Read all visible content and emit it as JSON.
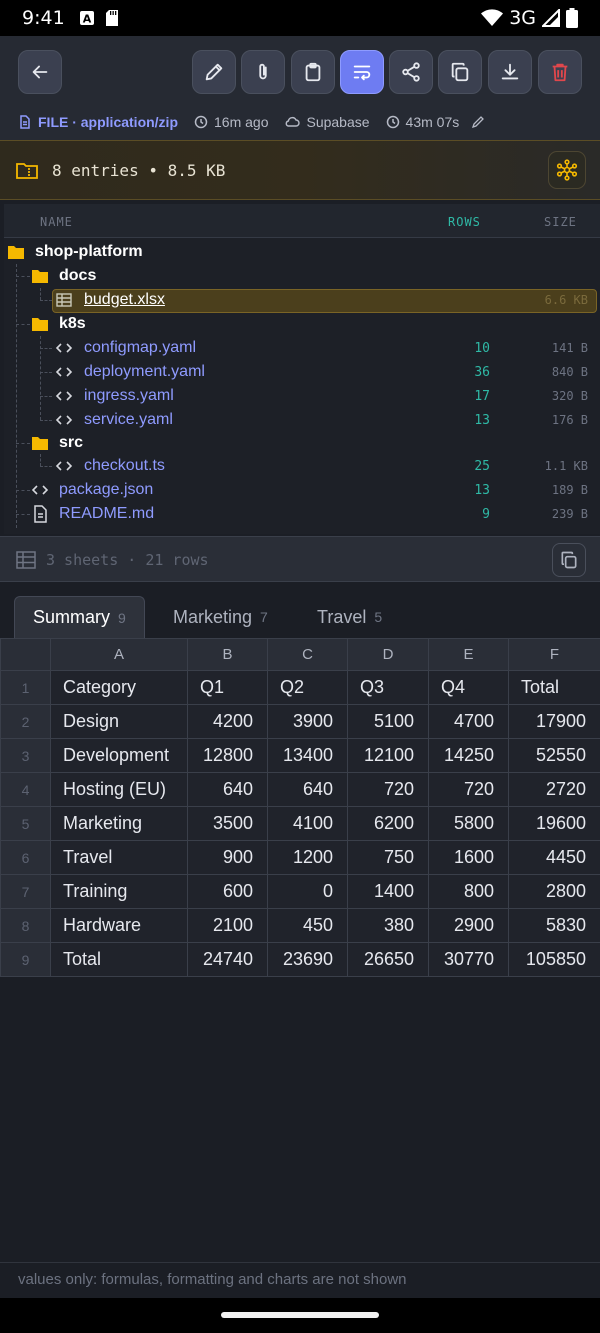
{
  "status": {
    "time": "9:41",
    "network": "3G"
  },
  "meta": {
    "file_label": "FILE · application/zip",
    "age": "16m ago",
    "storage": "Supabase",
    "duration": "43m 07s"
  },
  "banner": {
    "text": "8 entries • 8.5 KB"
  },
  "tree": {
    "headers": {
      "name": "NAME",
      "rows": "ROWS",
      "size": "SIZE"
    },
    "root": "shop-platform",
    "docs": "docs",
    "budget": {
      "name": "budget.xlsx",
      "size": "6.6 KB"
    },
    "k8s": "k8s",
    "configmap": {
      "name": "configmap.yaml",
      "rows": "10",
      "size": "141 B"
    },
    "deployment": {
      "name": "deployment.yaml",
      "rows": "36",
      "size": "840 B"
    },
    "ingress": {
      "name": "ingress.yaml",
      "rows": "17",
      "size": "320 B"
    },
    "service": {
      "name": "service.yaml",
      "rows": "13",
      "size": "176 B"
    },
    "src": "src",
    "checkout": {
      "name": "checkout.ts",
      "rows": "25",
      "size": "1.1 KB"
    },
    "package": {
      "name": "package.json",
      "rows": "13",
      "size": "189 B"
    },
    "readme": {
      "name": "README.md",
      "rows": "9",
      "size": "239 B"
    }
  },
  "sheets": {
    "summary": "3 sheets · 21 rows"
  },
  "tabs": [
    {
      "label": "Summary",
      "count": "9"
    },
    {
      "label": "Marketing",
      "count": "7"
    },
    {
      "label": "Travel",
      "count": "5"
    }
  ],
  "grid": {
    "columns": [
      "A",
      "B",
      "C",
      "D",
      "E",
      "F"
    ],
    "rows": [
      {
        "n": "1",
        "cells": [
          "Category",
          "Q1",
          "Q2",
          "Q3",
          "Q4",
          "Total"
        ]
      },
      {
        "n": "2",
        "cells": [
          "Design",
          "4200",
          "3900",
          "5100",
          "4700",
          "17900"
        ]
      },
      {
        "n": "3",
        "cells": [
          "Development",
          "12800",
          "13400",
          "12100",
          "14250",
          "52550"
        ]
      },
      {
        "n": "4",
        "cells": [
          "Hosting (EU)",
          "640",
          "640",
          "720",
          "720",
          "2720"
        ]
      },
      {
        "n": "5",
        "cells": [
          "Marketing",
          "3500",
          "4100",
          "6200",
          "5800",
          "19600"
        ]
      },
      {
        "n": "6",
        "cells": [
          "Travel",
          "900",
          "1200",
          "750",
          "1600",
          "4450"
        ]
      },
      {
        "n": "7",
        "cells": [
          "Training",
          "600",
          "0",
          "1400",
          "800",
          "2800"
        ]
      },
      {
        "n": "8",
        "cells": [
          "Hardware",
          "2100",
          "450",
          "380",
          "2900",
          "5830"
        ]
      },
      {
        "n": "9",
        "cells": [
          "Total",
          "24740",
          "23690",
          "26650",
          "30770",
          "105850"
        ]
      }
    ]
  },
  "footer": {
    "note": "values only: formulas, formatting and charts are not shown"
  },
  "colors": {
    "accent": "#6e7cf2",
    "link": "#8f9bff",
    "rows": "#2fb9a6",
    "folder": "#f5b800",
    "delete": "#e0474c"
  }
}
